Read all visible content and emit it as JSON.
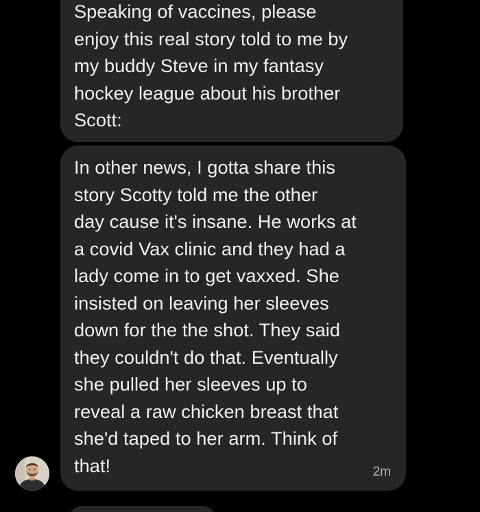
{
  "conversation": {
    "messages": [
      {
        "text": "Speaking of vaccines, please\nenjoy this real story told to me by\nmy buddy Steve in my fantasy\nhockey league about his brother\nScott:",
        "timestamp": ""
      },
      {
        "text": "In other news, I gotta share this\nstory Scotty told me the other\nday cause it's insane. He works at\na covid Vax clinic and they had a\nlady come in to get vaxxed. She\ninsisted on leaving her sleeves\ndown for the the shot. They said\nthey couldn't do that. Eventually\nshe pulled her sleeves up to\nreveal a raw chicken breast that\nshe'd taped to her arm. Think of\nthat!",
        "timestamp": "2m"
      }
    ],
    "avatar_icon": "user-photo-avatar"
  },
  "colors": {
    "background": "#000000",
    "bubble": "#262626",
    "text": "#f1f1f1",
    "timestamp": "#b5b5b5"
  }
}
